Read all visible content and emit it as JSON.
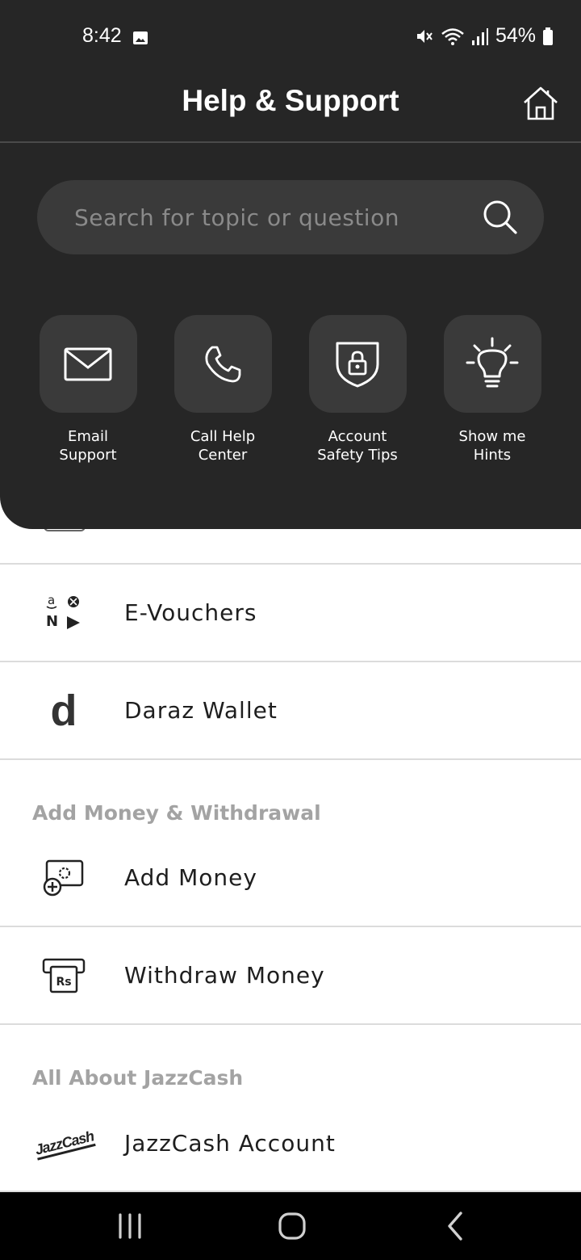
{
  "status_bar": {
    "time": "8:42",
    "battery": "54%"
  },
  "header": {
    "title": "Help & Support"
  },
  "search": {
    "placeholder": "Search for topic or question"
  },
  "quick_actions": [
    {
      "label": "Email\nSupport",
      "icon": "envelope-icon"
    },
    {
      "label": "Call Help\nCenter",
      "icon": "phone-icon"
    },
    {
      "label": "Account\nSafety Tips",
      "icon": "shield-lock-icon"
    },
    {
      "label": "Show me\nHints",
      "icon": "lightbulb-icon"
    }
  ],
  "list_top": [
    {
      "label": "E-Vouchers",
      "icon": "vouchers-brands-icon"
    },
    {
      "label": "Daraz Wallet",
      "icon": "daraz-logo-icon"
    }
  ],
  "sections": [
    {
      "title": "Add Money & Withdrawal",
      "items": [
        {
          "label": "Add Money",
          "icon": "add-money-icon"
        },
        {
          "label": "Withdraw Money",
          "icon": "withdraw-atm-icon"
        }
      ]
    },
    {
      "title": "All About JazzCash",
      "items": [
        {
          "label": "JazzCash Account",
          "icon": "jazzcash-logo-icon"
        }
      ]
    }
  ],
  "logos": {
    "jazzcash": "JazzCash",
    "withdraw_symbol": "Rs",
    "daraz": "d"
  },
  "colors": {
    "header_bg": "#262626",
    "tile_bg": "#3a3a3a",
    "section_title": "#a3a3a3"
  }
}
